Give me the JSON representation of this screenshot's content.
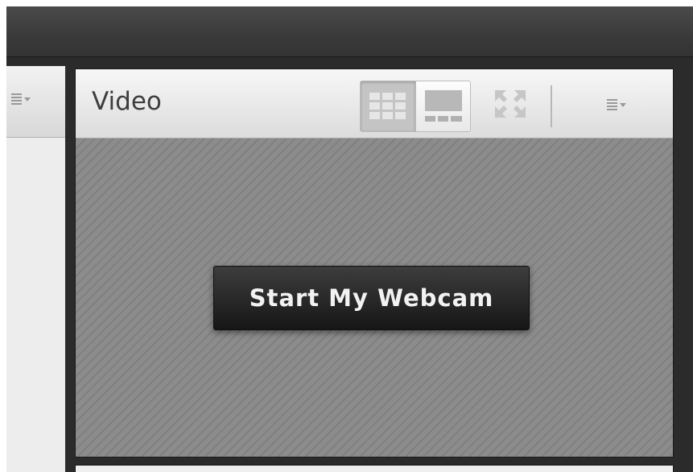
{
  "video_pod": {
    "title": "Video",
    "start_button_label": "Start My Webcam",
    "layout_options": [
      "grid-layout-icon",
      "filmstrip-layout-icon"
    ],
    "active_layout": "grid-layout-icon"
  },
  "icons": {
    "left_pod_menu": "menu-icon",
    "video_fullscreen": "fullscreen-icon",
    "video_menu": "menu-icon"
  },
  "colors": {
    "topbar": "#3a3a3a",
    "pod_header": "#e8e8e8",
    "video_stage": "#8c8c8c",
    "button": "#1f1f1f",
    "button_text": "#f2f2f2"
  }
}
